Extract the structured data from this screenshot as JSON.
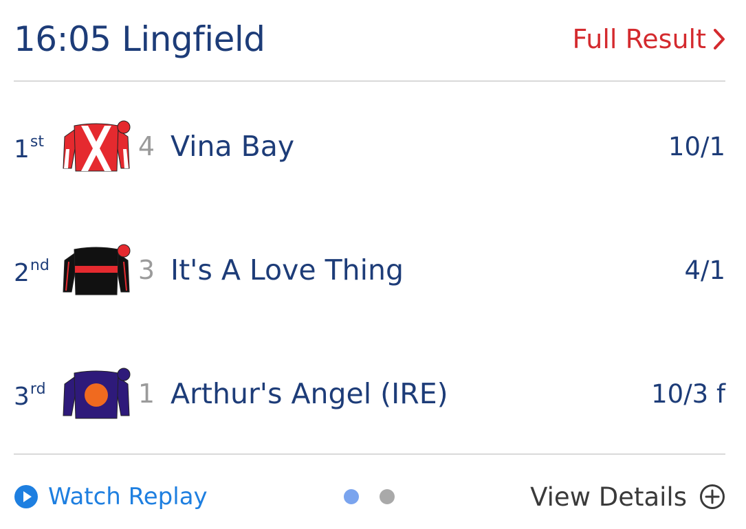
{
  "race": {
    "title": "16:05 Lingfield",
    "full_result_label": "Full Result"
  },
  "runners": [
    {
      "position": "1",
      "suffix": "st",
      "number": "4",
      "name": "Vina Bay",
      "odds": "10/1",
      "silk": {
        "body": "#e52a2f",
        "pattern": "white cross-belts",
        "sleeves": "white",
        "cap": "#e52a2f"
      }
    },
    {
      "position": "2",
      "suffix": "nd",
      "number": "3",
      "name": "It's A Love Thing",
      "odds": "4/1",
      "silk": {
        "body": "#111111",
        "pattern": "red hoop",
        "sleeves": "black, red seams",
        "cap": "#e52a2f"
      }
    },
    {
      "position": "3",
      "suffix": "rd",
      "number": "1",
      "name": "Arthur's Angel (IRE)",
      "odds": "10/3 f",
      "silk": {
        "body": "#2e1a7a",
        "pattern": "orange disc",
        "sleeves": "purple",
        "cap": "#2e1a7a"
      }
    }
  ],
  "footer": {
    "watch_replay_label": "Watch Replay",
    "view_details_label": "View Details",
    "pager": {
      "total": 2,
      "active": 1
    }
  },
  "colors": {
    "navy": "#1d3c78",
    "red": "#d42a2e",
    "link_blue": "#1e7fe0",
    "divider": "#d9d9d9"
  }
}
